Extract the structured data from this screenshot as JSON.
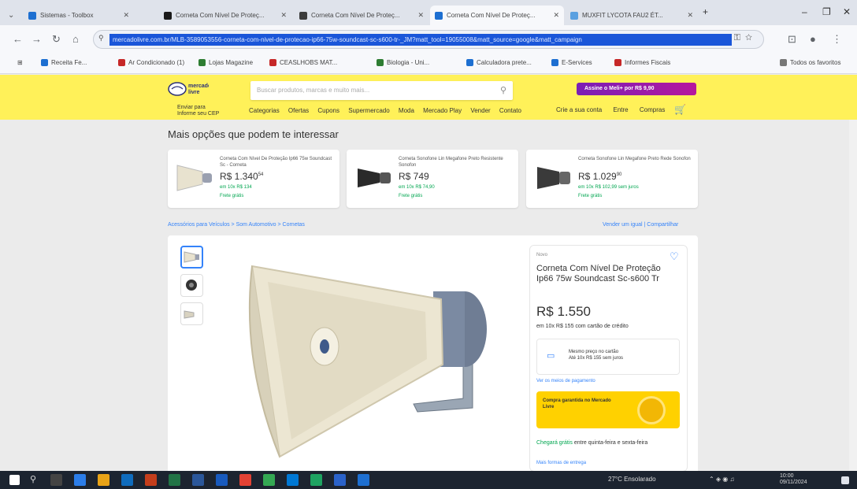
{
  "browser": {
    "tabs": [
      {
        "label": "Sistemas - Toolbox",
        "color": "#1d6fd1"
      },
      {
        "label": "Corneta Com Nível De Proteç...",
        "color": "#1a1a1a"
      },
      {
        "label": "Corneta Com Nível De Proteç...",
        "color": "#3c3c3c"
      },
      {
        "label": "Corneta Com Nível De Proteç...",
        "color": "#1d6fd1"
      },
      {
        "label": "MUXFIT LYCOTA FAU2 ÉT...",
        "color": "#5aa0e0"
      }
    ],
    "url": "mercadolivre.com.br/MLB-3589053556-corneta-com-nivel-de-protecao-ip66-75w-soundcast-sc-s600-tr-_JM?matt_tool=19055008&matt_source=google&matt_campaign",
    "bookmarks": [
      {
        "label": "Receita Fe...",
        "color": "#1d6fd1"
      },
      {
        "label": "Ar Condicionado (1)",
        "color": "#c62828"
      },
      {
        "label": "Lojas Magazine",
        "color": "#2e7d32"
      },
      {
        "label": "CEASLHOBS MAT...",
        "color": "#c62828"
      },
      {
        "label": "Biologia - Uni...",
        "color": "#2e7d32"
      },
      {
        "label": "Calculadora prete...",
        "color": "#1d6fd1"
      },
      {
        "label": "E-Services",
        "color": "#1d6fd1"
      },
      {
        "label": "Informes Fiscais",
        "color": "#c62828"
      },
      {
        "label": "Todos os favoritos",
        "color": "#777777"
      }
    ]
  },
  "site": {
    "logo_line1": "mercado",
    "logo_line2": "livre",
    "search_placeholder": "Buscar produtos, marcas e muito mais...",
    "promo": "Assine o Meli+ por R$ 9,90",
    "cep_line1": "Enviar para",
    "cep_line2": "Informe seu CEP",
    "categories": [
      "Categorias",
      "Ofertas",
      "Cupons",
      "Supermercado",
      "Moda",
      "Mercado Play",
      "Vender",
      "Contato"
    ],
    "header_right": [
      "Crie a sua conta",
      "Entre",
      "Compras"
    ]
  },
  "recs": {
    "title": "Mais opções que podem te interessar",
    "items": [
      {
        "name": "Corneta Com Nível De Proteção Ip66 75w Soundcast Sc - Corneta",
        "price": "R$ 1.340",
        "cents": "54",
        "installments": "em 10x R$ 134",
        "shipping": "Frete grátis",
        "color": "#e8e2cf"
      },
      {
        "name": "Corneta Sonofone Lin Megafone Preto Resistente Sonofon",
        "price": "R$ 749",
        "cents": "",
        "installments": "em 10x R$ 74,90",
        "shipping": "Frete grátis",
        "color": "#2a2a2a"
      },
      {
        "name": "Corneta Sonofone Lin Megafone Preto Rede Sonofon",
        "price": "R$ 1.029",
        "cents": "90",
        "installments": "em 10x R$ 102,99 sem juros",
        "shipping": "Frete grátis",
        "color": "#3a3a3a"
      }
    ]
  },
  "breadcrumb": "Acessórios para Veículos > Som Automotivo > Cornetas",
  "share": "Vender um igual  |  Compartilhar",
  "product": {
    "condition": "Novo",
    "title": "Corneta Com Nível De Proteção Ip66 75w Soundcast Sc-s600 Tr",
    "price": "R$ 1.550",
    "installments": "em 10x R$ 155 com cartão de crédito",
    "pay_line1": "Mesmo preço no cartão",
    "pay_line2": "Até 10x R$ 155 sem juros",
    "more_means": "Ver os meios de pagamento",
    "banner_text": "Compra garantida no Mercado Livre",
    "ship_green": "Chegará grátis",
    "ship_text": "entre quinta-feira e sexta-feira",
    "ship_more": "Mais formas de entrega"
  },
  "taskbar": {
    "weather": "27°C Ensolarado",
    "time": "10:00",
    "date": "09/11/2024"
  },
  "colors": {
    "header_yellow": "#fff159",
    "link_blue": "#3483fa",
    "green": "#00a650"
  }
}
